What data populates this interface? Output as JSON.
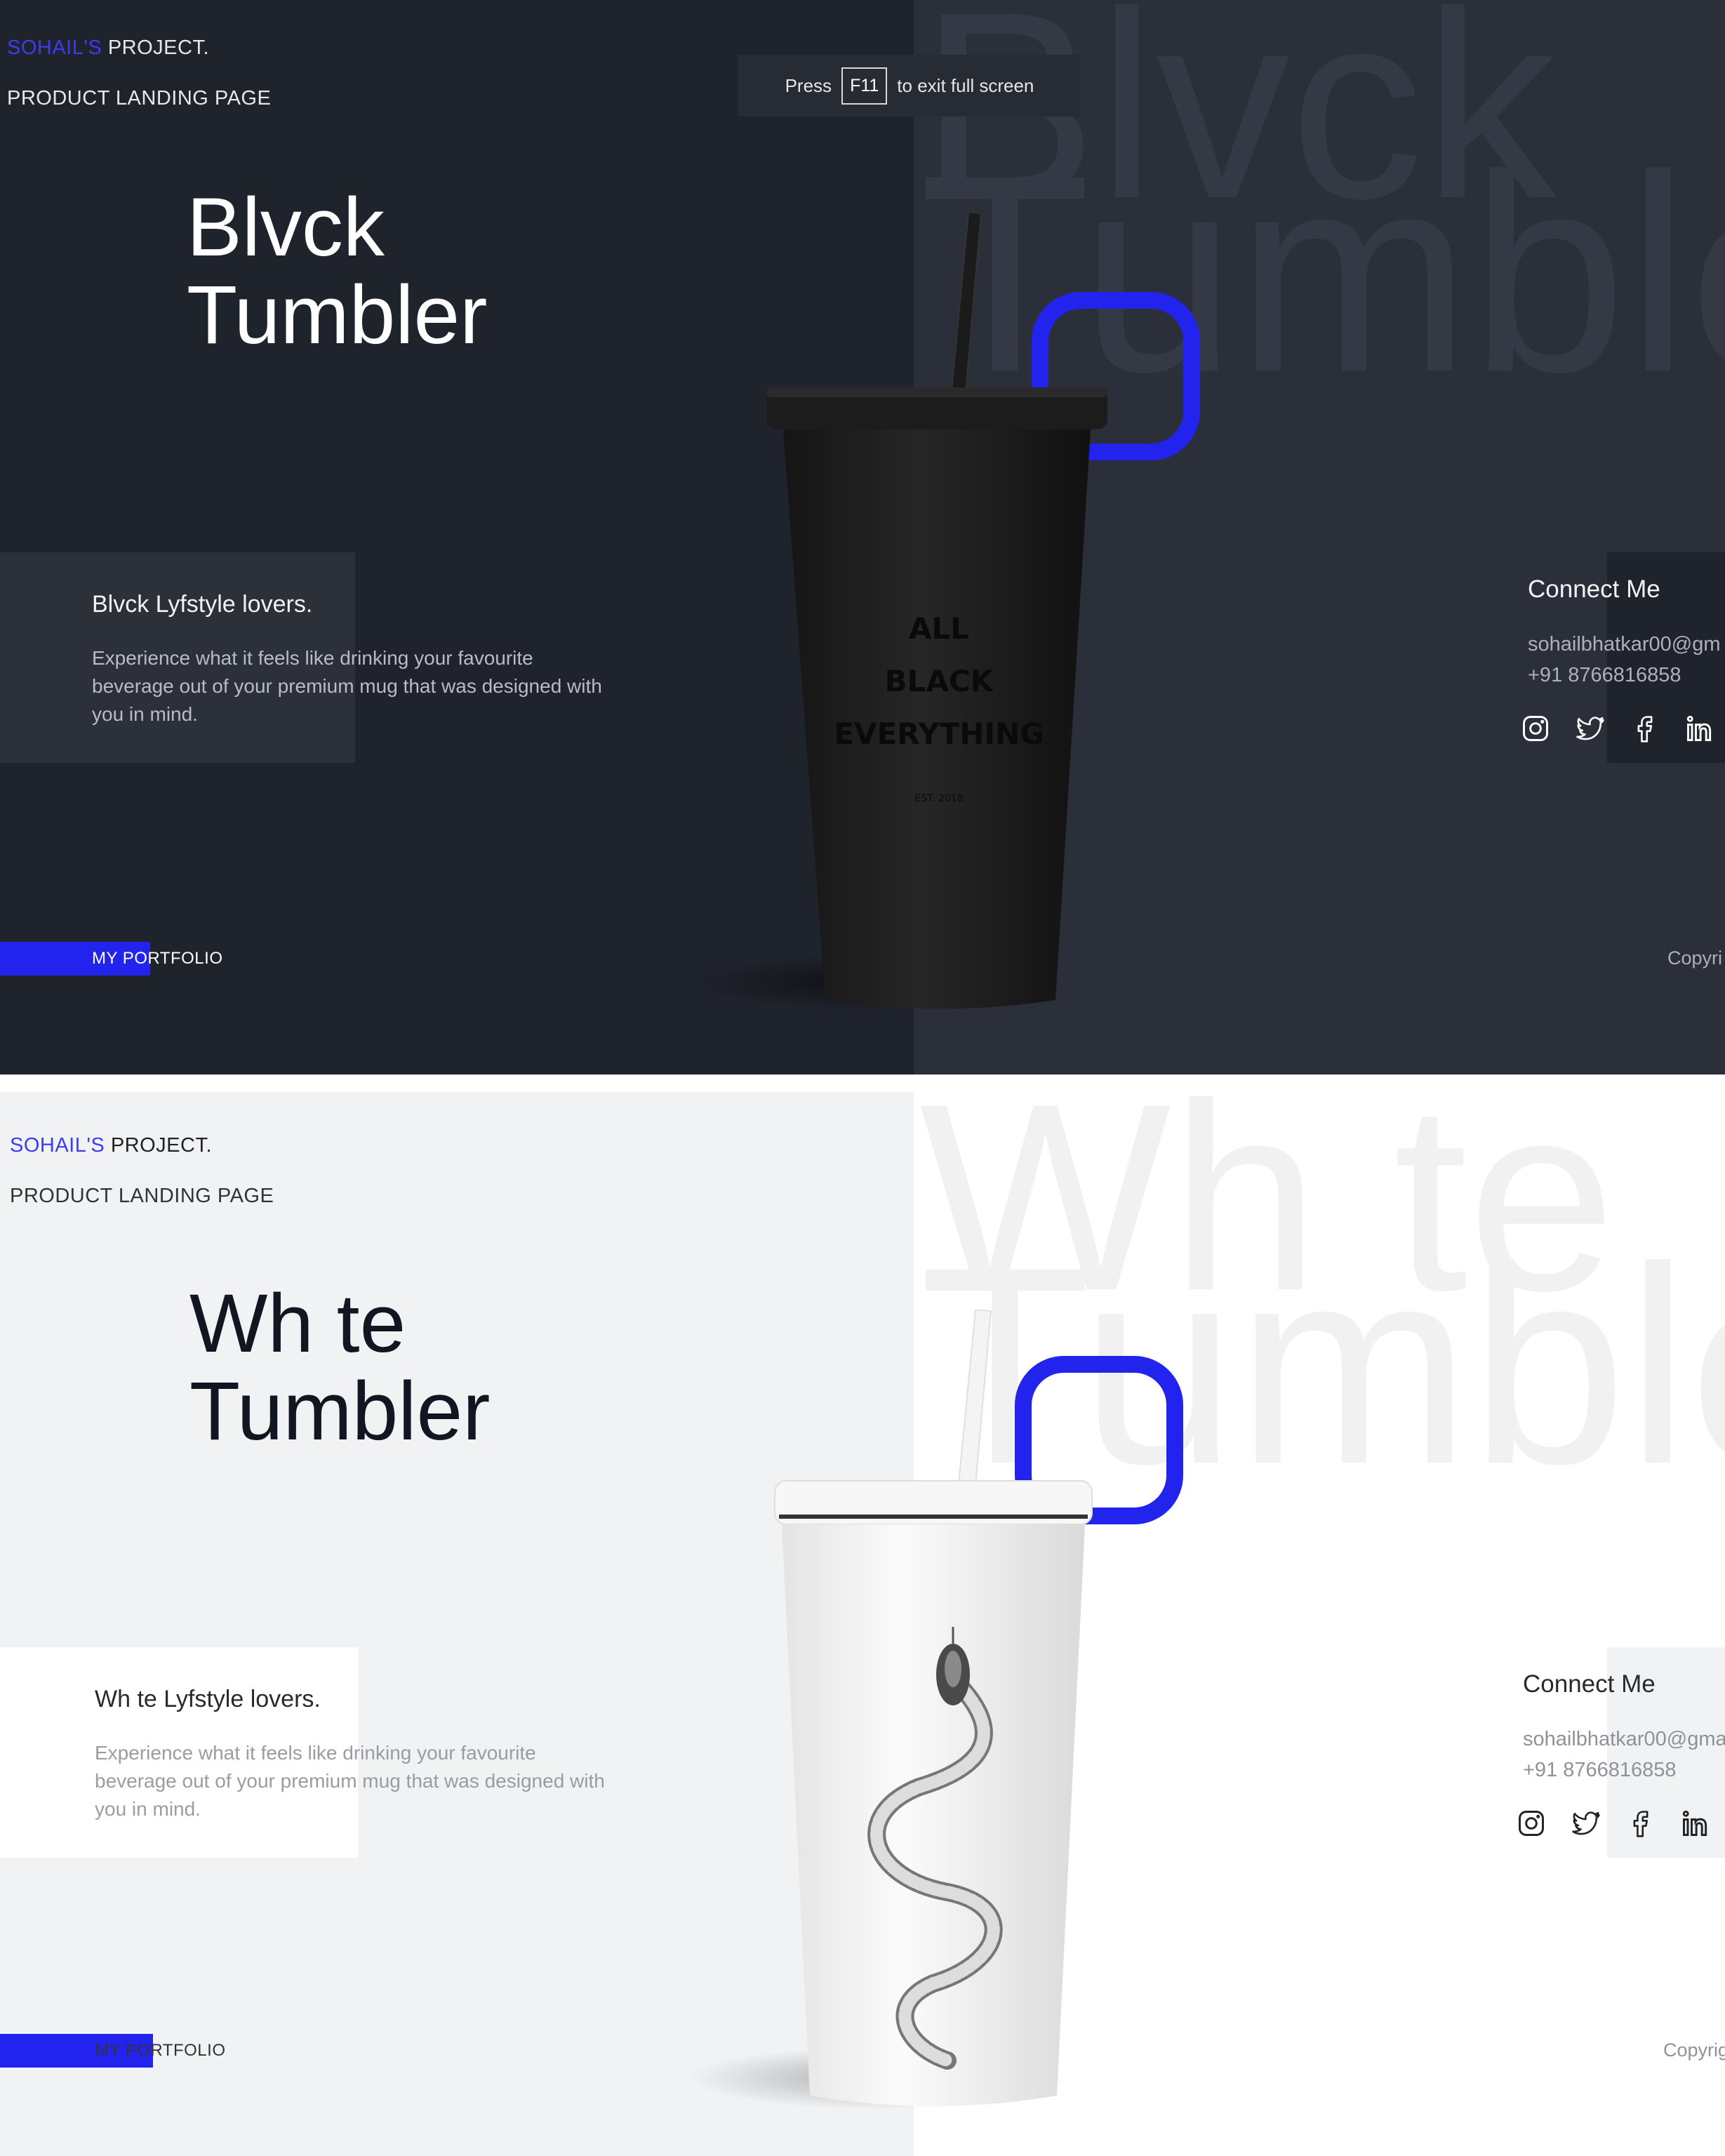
{
  "fullscreen_notice": {
    "press": "Press",
    "key": "F11",
    "rest": "to exit full screen"
  },
  "colors": {
    "accent": "#2323ee",
    "dark_bg": "#1f232c",
    "dark_right": "#2a2f39",
    "light_bg": "#f1f2f4",
    "light_right": "#ffffff"
  },
  "dark": {
    "brand_accent": "SOHAIL'S",
    "brand_rest": " PROJECT.",
    "subtitle": "PRODUCT LANDING PAGE",
    "title_line1": "Blvck",
    "title_line2": "Tumbler",
    "bg_line1": "Blvck",
    "bg_line2": "Tumbler",
    "info_title": "Blvck Lyfstyle lovers.",
    "info_desc": "Experience what it feels like drinking your favourite beverage out of your premium mug that was designed with you in mind.",
    "portfolio": "MY PORTFOLIO",
    "connect_title": "Connect Me",
    "email": "sohailbhatkar00@gm",
    "phone": "+91 8766816858",
    "copyright": "Copyri",
    "cup_text_1": "ALL",
    "cup_text_2": "BLACK",
    "cup_text_3": "EVERYTHING",
    "cup_est": "EST. 2018"
  },
  "light": {
    "brand_accent": "SOHAIL'S",
    "brand_rest": " PROJECT.",
    "subtitle": "PRODUCT LANDING PAGE",
    "title_line1": "Wh te",
    "title_line2": "Tumbler",
    "bg_line1": "Wh te",
    "bg_line2": "Tumbler",
    "info_title": "Wh te Lyfstyle lovers.",
    "info_desc": "Experience what it feels like drinking your favourite beverage out of your premium mug that was designed with you in mind.",
    "portfolio": "MY PORTFOLIO",
    "connect_title": "Connect Me",
    "email": "sohailbhatkar00@gma",
    "phone": "+91 8766816858",
    "copyright": "Copyrig"
  },
  "social_icons": [
    "instagram-icon",
    "twitter-icon",
    "facebook-icon",
    "linkedin-icon"
  ]
}
